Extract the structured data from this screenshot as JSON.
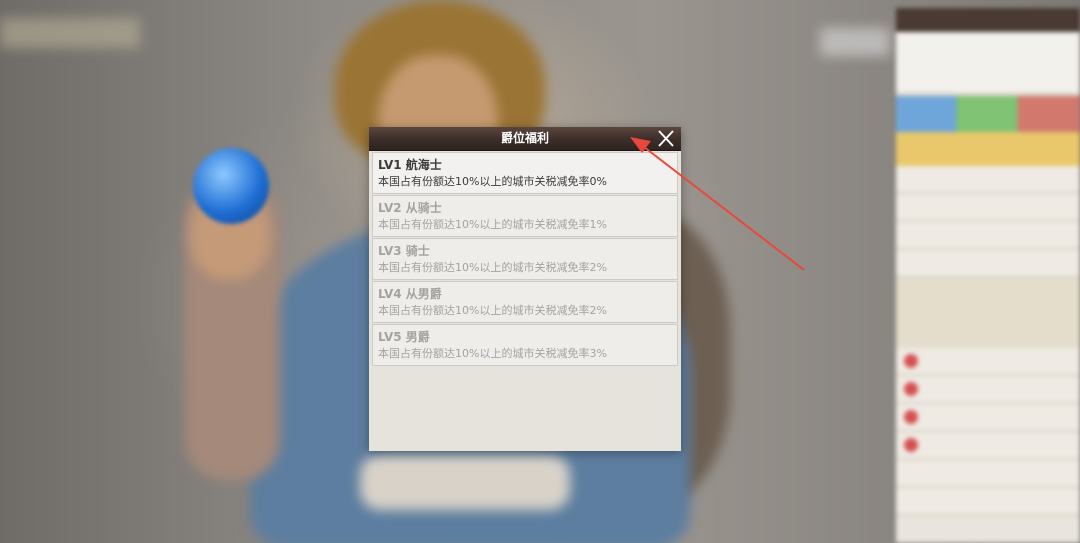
{
  "dialog": {
    "title": "爵位福利",
    "close_icon": "close-icon",
    "items": [
      {
        "level": "LV1 航海士",
        "description": "本国占有份额达10%以上的城市关税减免率0%",
        "unlocked": true
      },
      {
        "level": "LV2 从骑士",
        "description": "本国占有份额达10%以上的城市关税减免率1%",
        "unlocked": false
      },
      {
        "level": "LV3 骑士",
        "description": "本国占有份额达10%以上的城市关税减免率2%",
        "unlocked": false
      },
      {
        "level": "LV4 从男爵",
        "description": "本国占有份额达10%以上的城市关税减免率2%",
        "unlocked": false
      },
      {
        "level": "LV5 男爵",
        "description": "本国占有份额达10%以上的城市关税减免率3%",
        "unlocked": false
      }
    ]
  },
  "annotation": {
    "icon": "red-arrow-icon",
    "color": "#e8483c"
  },
  "colors": {
    "header": "#3b2d28",
    "panel": "#e6e2dc",
    "text_active": "#3b3b3b",
    "text_locked": "#a5a3a0"
  }
}
